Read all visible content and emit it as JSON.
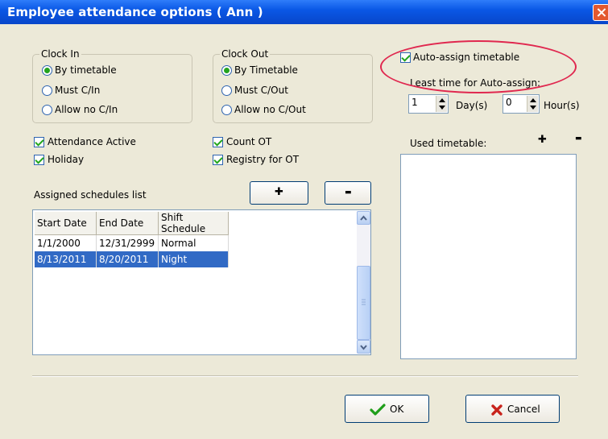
{
  "window": {
    "title": "Employee attendance options ( Ann )"
  },
  "clock_in": {
    "legend": "Clock In",
    "options": [
      "By timetable",
      "Must C/In",
      "Allow no C/In"
    ],
    "selected": "By timetable"
  },
  "clock_out": {
    "legend": "Clock Out",
    "options": [
      "By Timetable",
      "Must C/Out",
      "Allow no C/Out"
    ],
    "selected": "By Timetable"
  },
  "auto_assign": {
    "label": "Auto-assign timetable",
    "checked": true,
    "least_time_label": "Least time for Auto-assign:",
    "days_value": "1",
    "days_label": "Day(s)",
    "hours_value": "0",
    "hours_label": "Hour(s)"
  },
  "checkboxes": {
    "attendance_active": "Attendance Active",
    "holiday": "Holiday",
    "count_ot": "Count OT",
    "registry_for_ot": "Registry for OT"
  },
  "used_timetable": {
    "label": "Used timetable:",
    "add_glyph": "✚",
    "remove_glyph": "▬"
  },
  "schedules": {
    "label": "Assigned schedules list",
    "add_glyph": "✚",
    "remove_glyph": "▬",
    "columns": [
      "Start Date",
      "End Date",
      "Shift Schedule"
    ],
    "rows": [
      {
        "start": "1/1/2000",
        "end": "12/31/2999",
        "shift": "Normal",
        "selected": false
      },
      {
        "start": "8/13/2011",
        "end": "8/20/2011",
        "shift": "Night",
        "selected": true
      }
    ]
  },
  "buttons": {
    "ok": "OK",
    "cancel": "Cancel"
  },
  "colors": {
    "title_bar": "#0a58e6",
    "selection": "#316ac5",
    "highlight_oval": "#e0284f"
  }
}
